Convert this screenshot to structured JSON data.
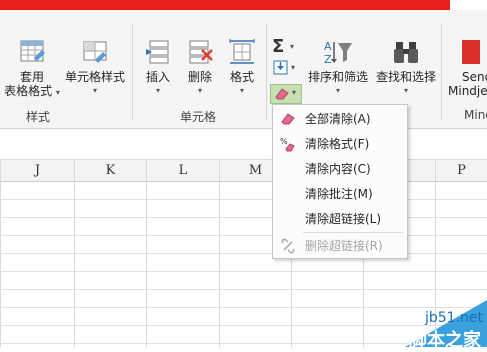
{
  "ribbon": {
    "styles_group": {
      "table_format_line1": "套用",
      "table_format_line2": "表格格式",
      "cell_styles": "单元格样式",
      "label": "样式"
    },
    "cells_group": {
      "insert": "插入",
      "delete": "删除",
      "format": "格式",
      "label": "单元格"
    },
    "editing_group": {
      "sort_filter": "排序和筛选",
      "find_select": "查找和选择"
    },
    "cutoff_group": {
      "line1": "Send",
      "line2": "Mindje",
      "label": "Mind"
    }
  },
  "columns": [
    "J",
    "K",
    "L",
    "M",
    "P"
  ],
  "clear_menu": {
    "items": [
      {
        "label": "全部清除(A)",
        "icon": "eraser-icon",
        "disabled": false
      },
      {
        "label": "清除格式(F)",
        "icon": "clear-format-icon",
        "disabled": false
      },
      {
        "label": "清除内容(C)",
        "icon": "",
        "disabled": false
      },
      {
        "label": "清除批注(M)",
        "icon": "",
        "disabled": false
      },
      {
        "label": "清除超链接(L)",
        "icon": "",
        "disabled": false
      },
      {
        "label": "删除超链接(R)",
        "icon": "remove-link-icon",
        "disabled": true
      }
    ]
  },
  "watermark": {
    "site": "jb51.net",
    "brand": "脚本之家"
  },
  "colors": {
    "accent_red": "#e8211b",
    "highlight_green": "#c6e0b4",
    "eraser_pink": "#e26b8a"
  }
}
